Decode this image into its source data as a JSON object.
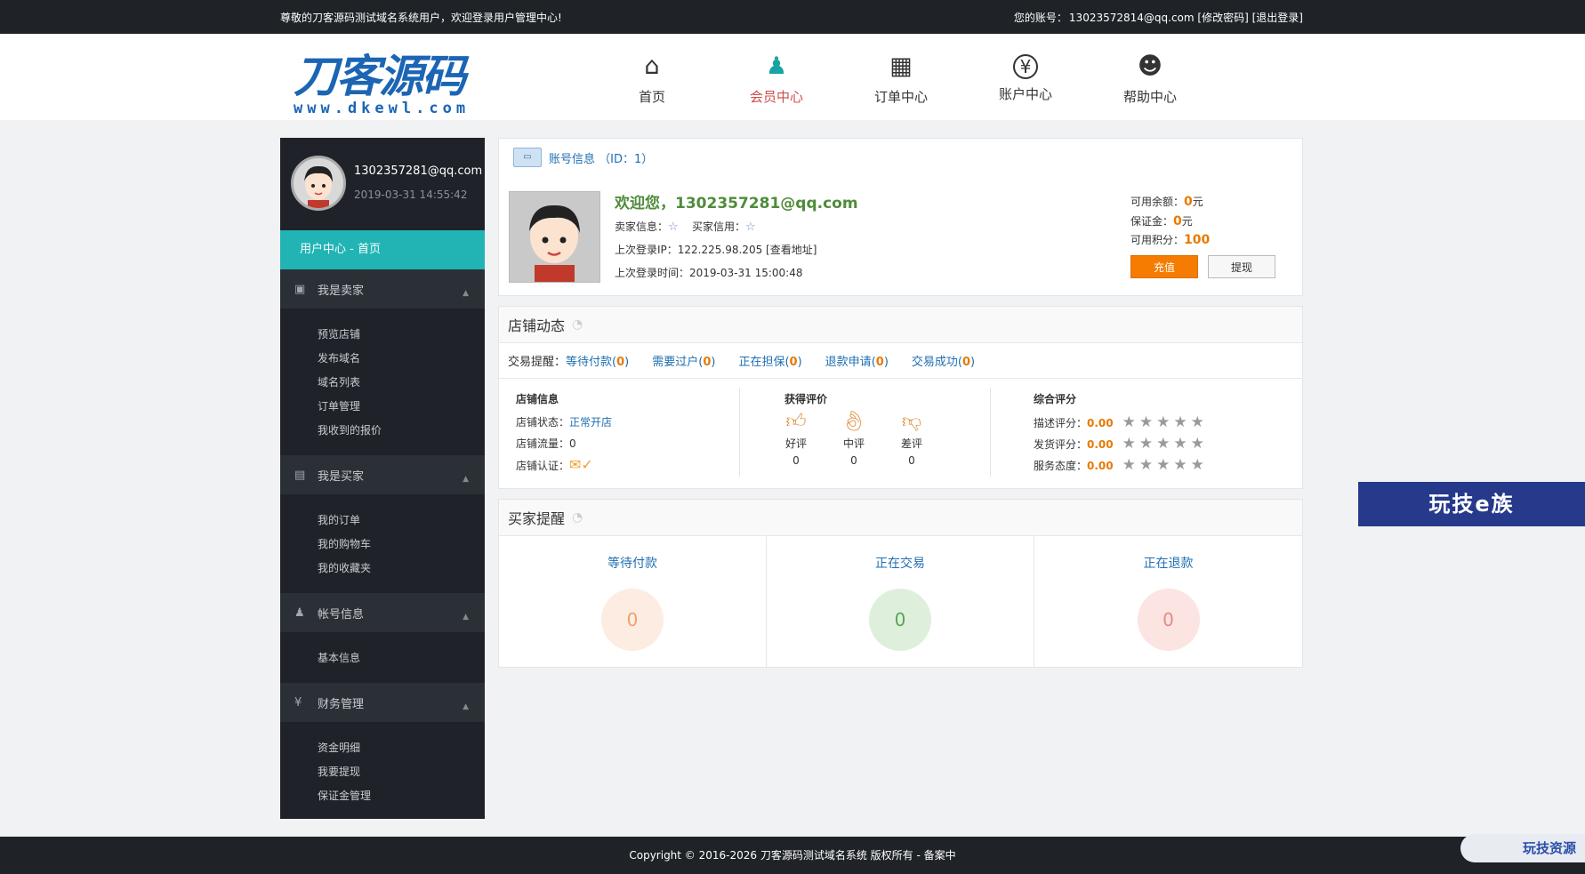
{
  "topbar": {
    "welcome": "尊敬的刀客源码测试域名系统用户，欢迎登录用户管理中心!",
    "account_label": "您的账号：",
    "account_value": "13023572814@qq.com",
    "change_pwd": "[修改密码]",
    "logout": "[退出登录]"
  },
  "logo": {
    "title": "刀客源码",
    "sub": "www.dkewl.com"
  },
  "nav": [
    {
      "label": "首页",
      "icon": "home-icon",
      "glyph": "⌂"
    },
    {
      "label": "会员中心",
      "icon": "member-icon",
      "glyph": "♟"
    },
    {
      "label": "订单中心",
      "icon": "order-icon",
      "glyph": "▦"
    },
    {
      "label": "账户中心",
      "icon": "yuan-icon",
      "glyph": "¥"
    },
    {
      "label": "帮助中心",
      "icon": "smile-icon",
      "glyph": "☻"
    }
  ],
  "sidebar": {
    "user_email": "1302357281@qq.com",
    "user_time": "2019-03-31 14:55:42",
    "home": "用户中心 - 首页",
    "groups": [
      {
        "title": "我是卖家",
        "items": [
          "预览店铺",
          "发布域名",
          "域名列表",
          "订单管理",
          "我收到的报价"
        ]
      },
      {
        "title": "我是买家",
        "items": [
          "我的订单",
          "我的购物车",
          "我的收藏夹"
        ]
      },
      {
        "title": "帐号信息",
        "items": [
          "基本信息"
        ]
      },
      {
        "title": "财务管理",
        "items": [
          "资金明细",
          "我要提现",
          "保证金管理"
        ]
      }
    ]
  },
  "account": {
    "title": "账号信息 （ID：1）",
    "welcome": "欢迎您，1302357281@qq.com",
    "seller_label": "卖家信息：",
    "buyer_label": "买家信用：",
    "ip_label": "上次登录IP：",
    "ip_value": "122.225.98.205",
    "ip_link": "[查看地址]",
    "last_time_label": "上次登录时间：",
    "last_time_value": "2019-03-31 15:00:48",
    "balance_label": "可用余额：",
    "balance_value": "0",
    "deposit_label": "保证金：",
    "deposit_value": "0",
    "unit": "元",
    "points_label": "可用积分：",
    "points_value": "100",
    "charge_btn": "充值",
    "withdraw_btn": "提现"
  },
  "shop": {
    "title": "店铺动态",
    "trade_label": "交易提醒：",
    "trades": [
      {
        "label": "等待付款",
        "count": "0"
      },
      {
        "label": "需要过户",
        "count": "0"
      },
      {
        "label": "正在担保",
        "count": "0"
      },
      {
        "label": "退款申请",
        "count": "0"
      },
      {
        "label": "交易成功",
        "count": "0"
      }
    ],
    "info_title": "店铺信息",
    "status_label": "店铺状态：",
    "status_value": "正常开店",
    "traffic_label": "店铺流量：",
    "traffic_value": "0",
    "cert_label": "店铺认证：",
    "eval_title": "获得评价",
    "evals": [
      {
        "label": "好评",
        "count": "0"
      },
      {
        "label": "中评",
        "count": "0"
      },
      {
        "label": "差评",
        "count": "0"
      }
    ],
    "score_title": "综合评分",
    "scores": [
      {
        "label": "描述评分：",
        "value": "0.00"
      },
      {
        "label": "发货评分：",
        "value": "0.00"
      },
      {
        "label": "服务态度：",
        "value": "0.00"
      }
    ]
  },
  "buyer": {
    "title": "买家提醒",
    "cols": [
      {
        "label": "等待付款",
        "count": "0",
        "bg": "#fdece1",
        "fg": "#f0a070"
      },
      {
        "label": "正在交易",
        "count": "0",
        "bg": "#def0dc",
        "fg": "#5aa35a"
      },
      {
        "label": "正在退款",
        "count": "0",
        "bg": "#fbe4e2",
        "fg": "#e58b80"
      }
    ]
  },
  "badges": {
    "side": "玩技e族",
    "footer": "玩技资源"
  },
  "footer": {
    "copyright": "Copyright © 2016-2026 刀客源码测试域名系统 版权所有 - 备案中"
  }
}
